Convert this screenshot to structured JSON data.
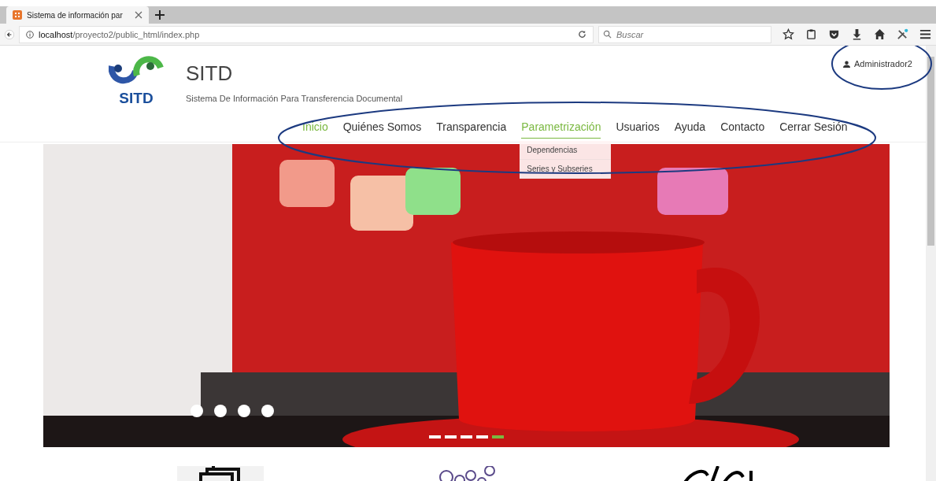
{
  "browser": {
    "tab": {
      "title": "Sistema de información par"
    },
    "address": {
      "host": "localhost",
      "path": "/proyecto2/public_html/index.php"
    },
    "search": {
      "placeholder": "Buscar"
    }
  },
  "user": {
    "name": "Administrador2"
  },
  "brand": {
    "logo_text": "SITD",
    "title": "SITD",
    "subtitle": "Sistema De Información Para Transferencia Documental"
  },
  "nav": [
    {
      "label": "Inicio",
      "selected": true
    },
    {
      "label": "Quiénes Somos",
      "selected": false
    },
    {
      "label": "Transparencia",
      "selected": false
    },
    {
      "label": "Parametrización",
      "selected": false,
      "expanded": true,
      "children": [
        {
          "label": "Dependencias"
        },
        {
          "label": "Series y Subseries"
        }
      ]
    },
    {
      "label": "Usuarios",
      "selected": false
    },
    {
      "label": "Ayuda",
      "selected": false
    },
    {
      "label": "Contacto",
      "selected": false
    },
    {
      "label": "Cerrar Sesión",
      "selected": false
    }
  ],
  "hero": {
    "kind": "picture",
    "indicators": [
      {
        "selected": false
      },
      {
        "selected": false
      },
      {
        "selected": false
      },
      {
        "selected": false
      },
      {
        "selected": true
      }
    ]
  }
}
